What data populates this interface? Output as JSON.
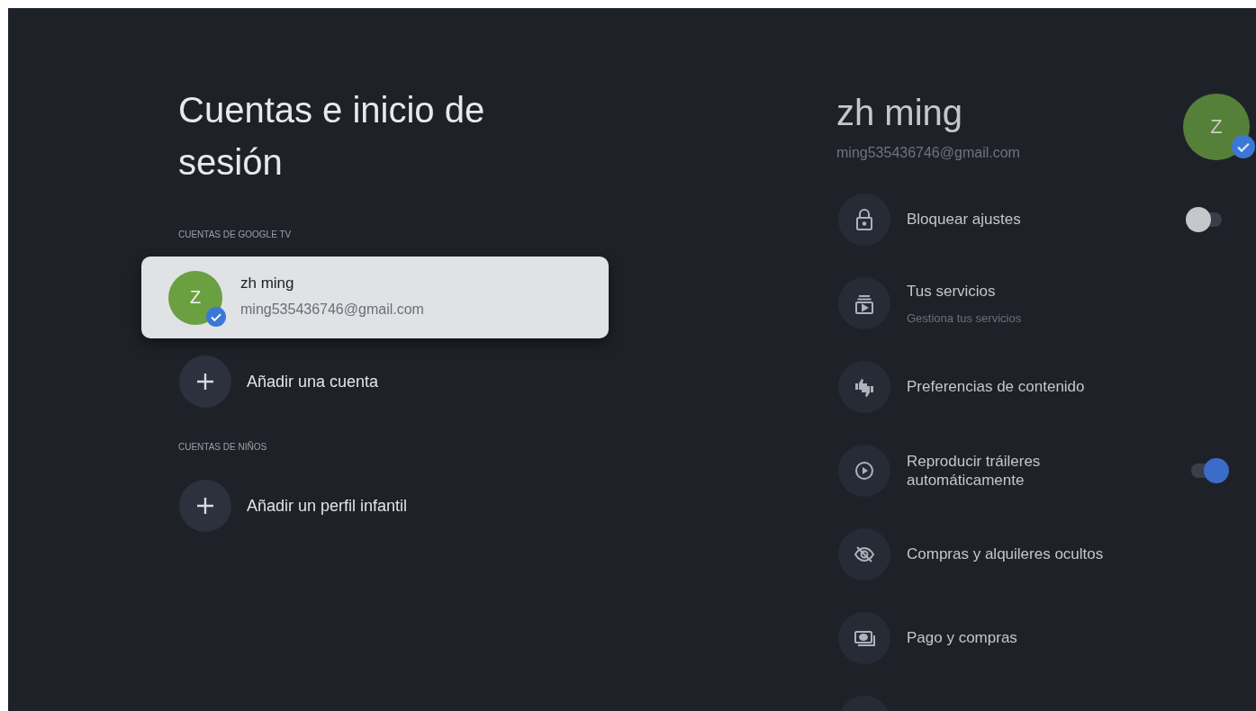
{
  "left": {
    "title": "Cuentas e inicio de sesión",
    "sections": [
      {
        "label": "CUENTAS DE GOOGLE TV",
        "accounts": [
          {
            "initial": "Z",
            "name": "zh ming",
            "email": "ming535436746@gmail.com",
            "selected": true,
            "verified": true
          }
        ],
        "add_label": "Añadir una cuenta"
      },
      {
        "label": "CUENTAS DE NIÑOS",
        "add_label": "Añadir un perfil infantil"
      }
    ]
  },
  "profile": {
    "name": "zh ming",
    "email": "ming535436746@gmail.com",
    "initial": "Z",
    "verified": true
  },
  "items": [
    {
      "kind": "toggle",
      "label": "Bloquear ajustes",
      "on": false
    },
    {
      "kind": "link",
      "label": "Tus servicios",
      "subtitle": "Gestiona tus servicios"
    },
    {
      "kind": "link",
      "label": "Preferencias de contenido"
    },
    {
      "kind": "toggle",
      "label": "Reproducir tráileres automáticamente",
      "on": true
    },
    {
      "kind": "link",
      "label": "Compras y alquileres ocultos"
    },
    {
      "kind": "link",
      "label": "Pago y compras"
    }
  ]
}
